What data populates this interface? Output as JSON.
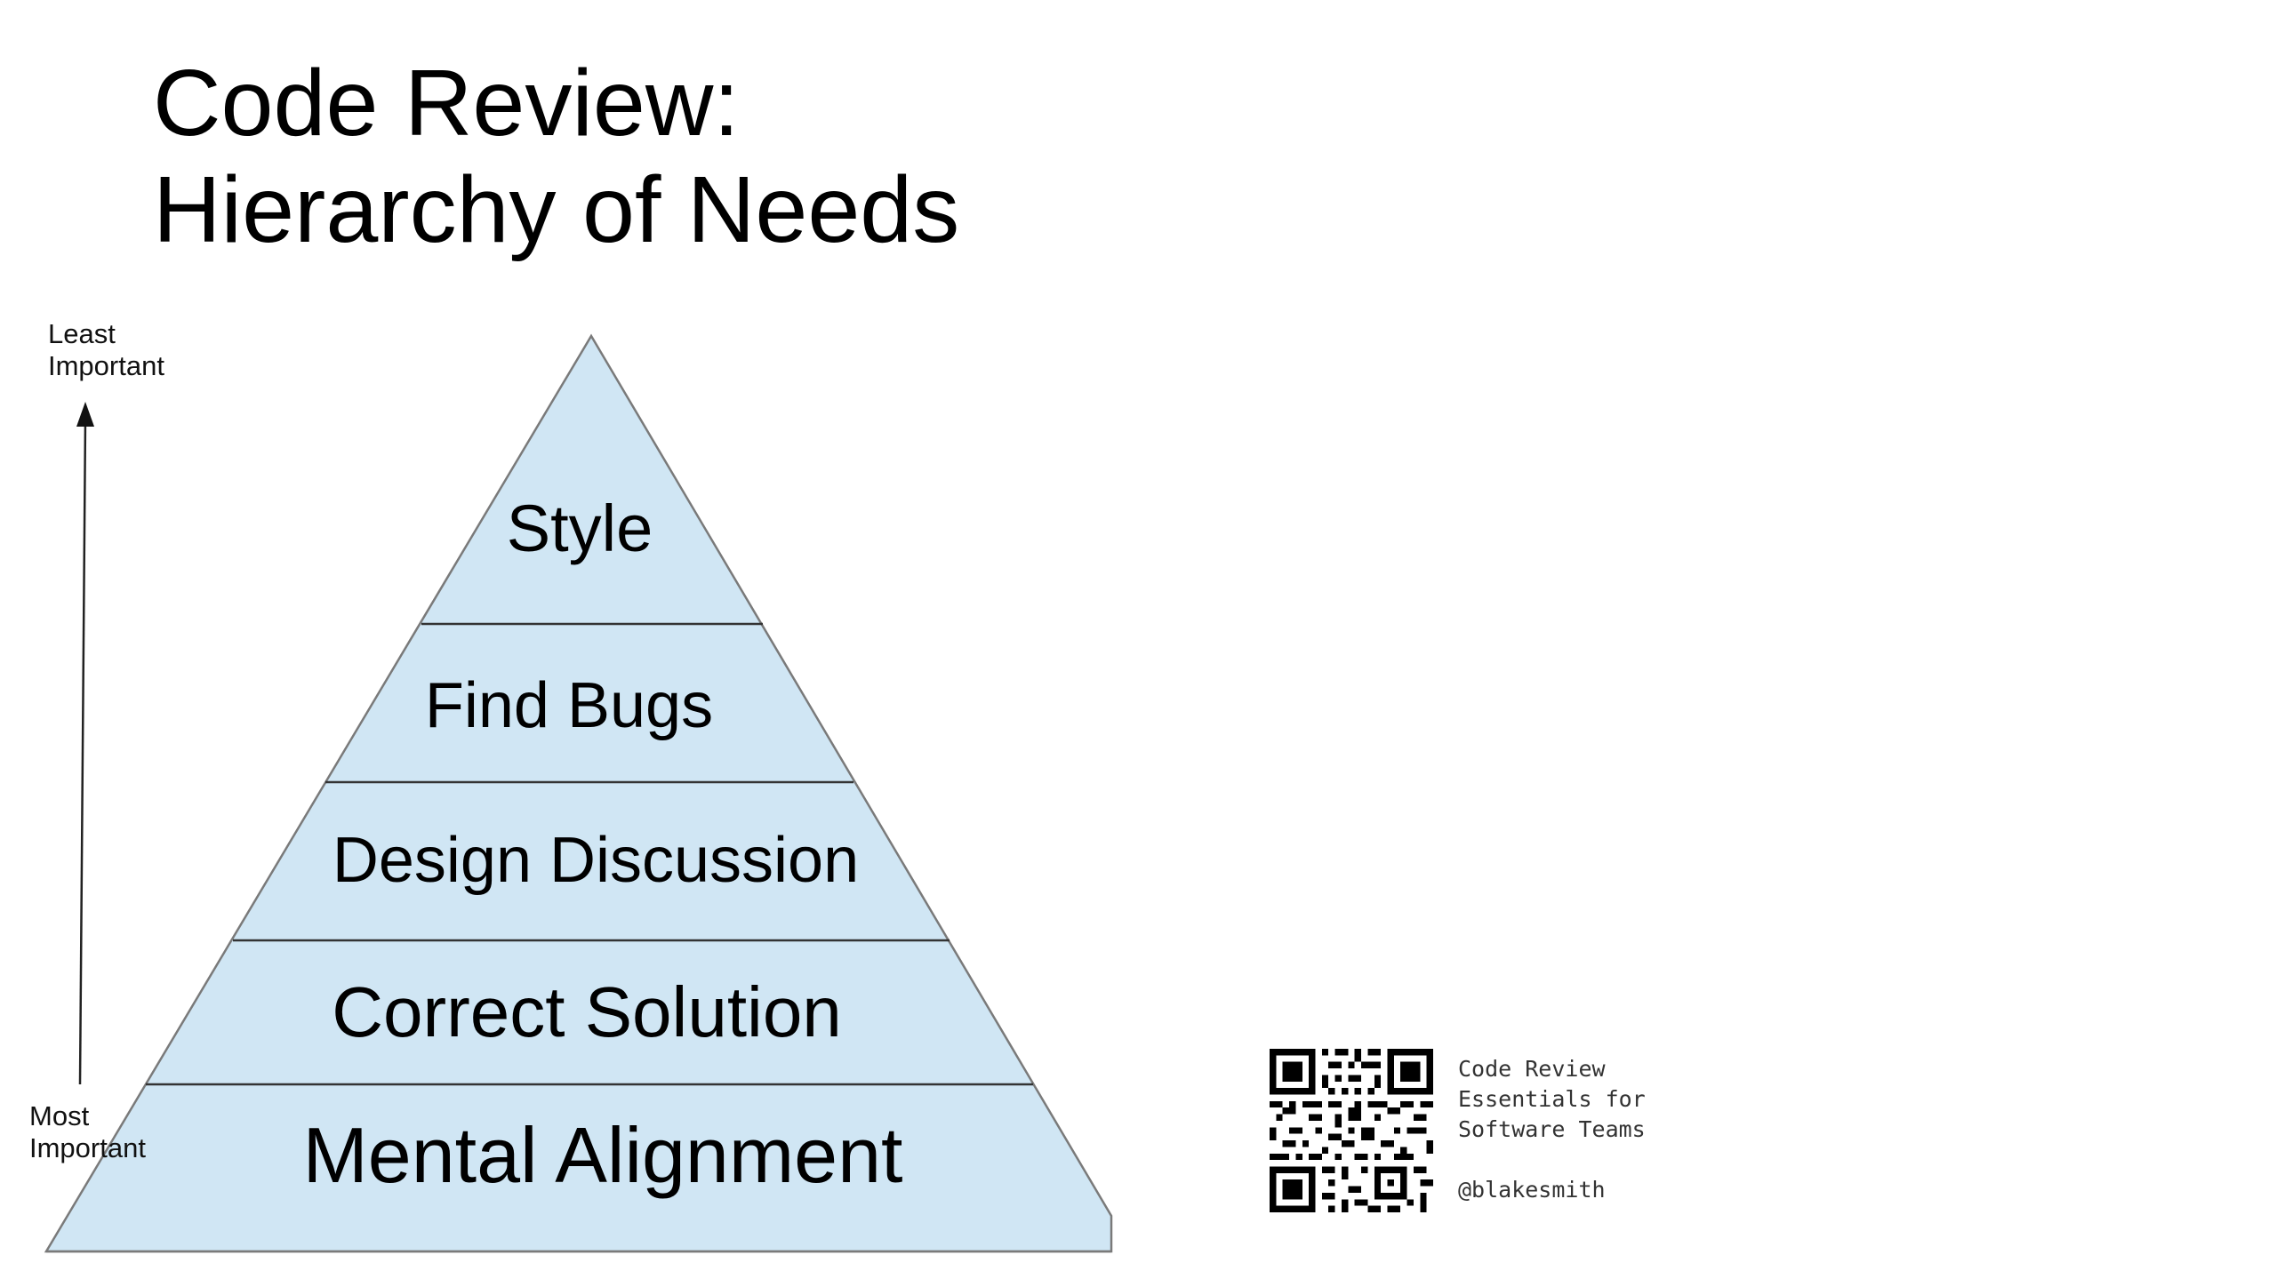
{
  "slide": {
    "title_line1": "Code Review:",
    "title_line2": "Hierarchy of Needs"
  },
  "scale": {
    "top_line1": "Least",
    "top_line2": "Important",
    "bottom_line1": "Most",
    "bottom_line2": "Important"
  },
  "pyramid": {
    "fill_color": "#d0e6f4",
    "levels": [
      {
        "label": "Style"
      },
      {
        "label": "Find Bugs"
      },
      {
        "label": "Design Discussion"
      },
      {
        "label": "Correct Solution"
      },
      {
        "label": "Mental Alignment"
      }
    ]
  },
  "footer": {
    "qr_icon": "qr-code-icon",
    "line1": "Code Review",
    "line2": "Essentials for",
    "line3": "Software Teams",
    "handle": "@blakesmith"
  }
}
